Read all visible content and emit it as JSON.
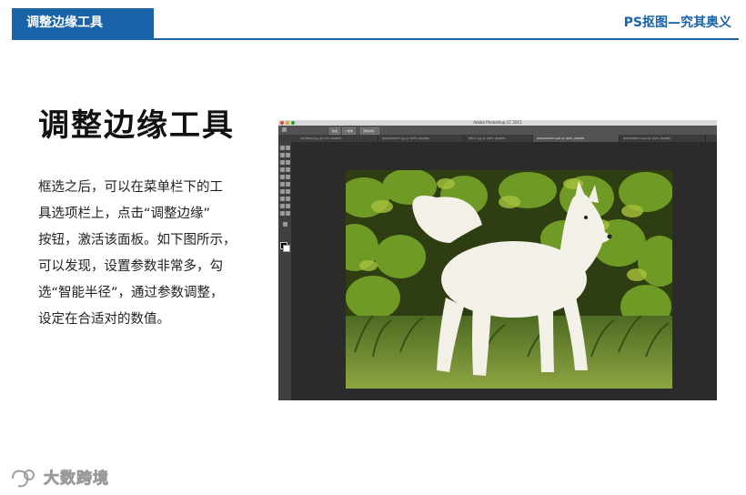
{
  "header": {
    "tab_label": "调整边缘工具",
    "brand": "PS抠图—究其奥义",
    "accent": "#1a63a9"
  },
  "title": "调整边缘工具",
  "body_lines": [
    "框选之后，可以在菜单栏下的工",
    "具选项栏上，点击“调整边缘”",
    "按钮，激活该面板。如下图所示，",
    "可以发现，设置参数非常多，勾",
    "选“智能半径”，通过参数调整，",
    "设定在合适对的数值。"
  ],
  "screenshot": {
    "app_title": "Adobe Photoshop CC 2015",
    "option_buttons": [
      "新选",
      "1 像素",
      "调整边缘..."
    ],
    "tabs": [
      "20160942.jpg @ 33% (RGB/8)",
      "QQ20160207.jpg @ 100% (RGB/8)",
      "IMG-1.jpg @ 100% (RGB/8)",
      "QQ20160221.psd @ 100% (RGB/8)",
      "QQ20160221.psd @ 100% (RGB/8)"
    ],
    "image_icon": "samoyed-dog-photo"
  },
  "watermark": {
    "text": "大数跨境",
    "icon": "logo-icon"
  }
}
